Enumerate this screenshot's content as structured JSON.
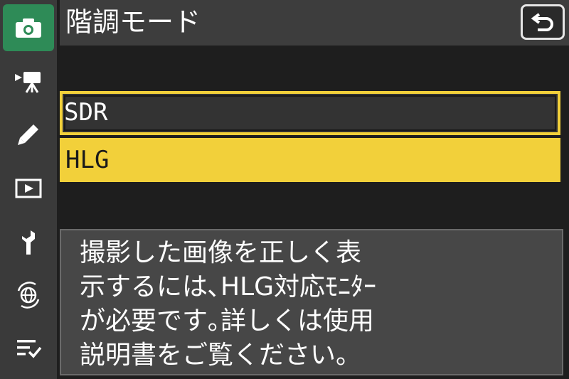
{
  "sidebar": {
    "items": [
      {
        "icon": "camera-icon",
        "active": true
      },
      {
        "icon": "video-camera-icon",
        "active": false
      },
      {
        "icon": "pencil-icon",
        "active": false
      },
      {
        "icon": "playback-icon",
        "active": false
      },
      {
        "icon": "wrench-icon",
        "active": false
      },
      {
        "icon": "network-globe-icon",
        "active": false
      },
      {
        "icon": "my-menu-icon",
        "active": false
      }
    ]
  },
  "header": {
    "title": "階調モード",
    "back_icon": "return-arrow-icon"
  },
  "options": [
    {
      "label": "SDR",
      "state": "focused"
    },
    {
      "label": "HLG",
      "state": "selected"
    }
  ],
  "help": {
    "lines": [
      "撮影した画像を正しく表",
      "示するには､HLG対応ﾓﾆﾀｰ",
      "が必要です｡詳しくは使用",
      "説明書をご覧ください。"
    ]
  },
  "colors": {
    "accent_yellow": "#f2d03a",
    "active_tab_green": "#2e8b57",
    "sidebar_gray": "#3a3a3a",
    "background": "#1e1e1e"
  }
}
